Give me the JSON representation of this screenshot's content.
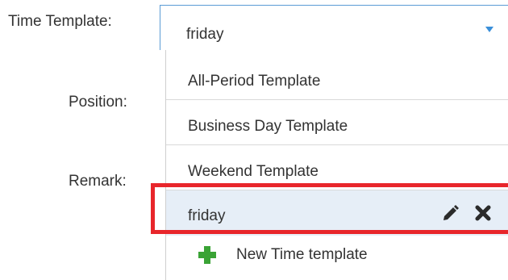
{
  "form": {
    "time_template_label": "Time Template:",
    "position_label": "Position:",
    "remark_label": "Remark:"
  },
  "time_template_select": {
    "selected_value": "friday",
    "arrow_icon": "caret-down-icon",
    "accent_color": "#3a8fd9"
  },
  "dropdown": {
    "options": [
      {
        "label": "All-Period Template"
      },
      {
        "label": "Business Day Template"
      },
      {
        "label": "Weekend Template"
      },
      {
        "label": "friday",
        "highlighted": true,
        "actions": [
          "pencil-icon",
          "close-icon"
        ]
      }
    ],
    "new_item": {
      "label": "New Time template",
      "icon": "plus-icon",
      "icon_color": "#3aa335"
    },
    "highlight_color": "#e8262b"
  }
}
